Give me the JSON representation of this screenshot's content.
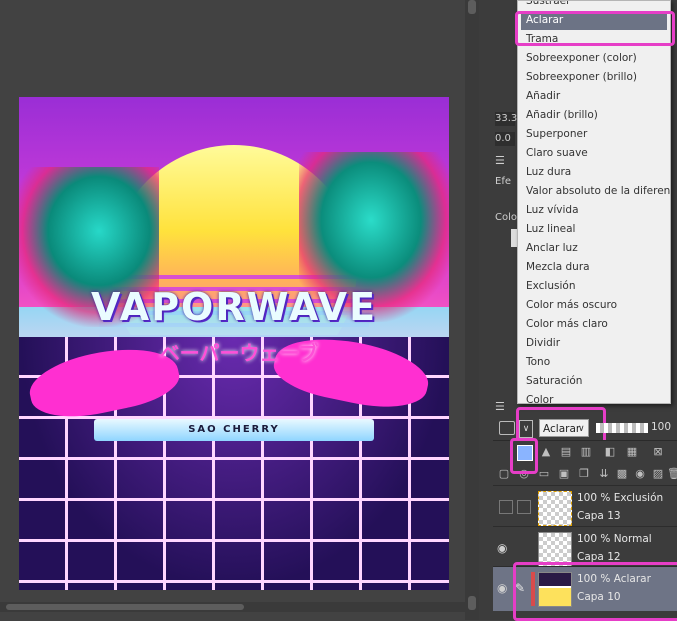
{
  "artwork": {
    "title": "VAPORWAVE",
    "subtitle": "ベーパーウェーブ",
    "credit": "SAO CHERRY"
  },
  "panel": {
    "value_a": "33.3",
    "value_b": "0.0",
    "label_efe": "Efe",
    "label_colo": "Colo"
  },
  "blend_menu": {
    "items": [
      "Sustraer",
      "Aclarar",
      "Trama",
      "Sobreexponer (color)",
      "Sobreexponer (brillo)",
      "Añadir",
      "Añadir (brillo)",
      "Superponer",
      "Claro suave",
      "Luz dura",
      "Valor absoluto de la diferencia",
      "Luz vívida",
      "Luz lineal",
      "Anclar luz",
      "Mezcla dura",
      "Exclusión",
      "Color más oscuro",
      "Color más claro",
      "Dividir",
      "Tono",
      "Saturación",
      "Color"
    ],
    "selected": "Aclarar"
  },
  "layer_toolbar": {
    "blend_mode": "Aclarar",
    "opacity": "100"
  },
  "layers": [
    {
      "mode": "100 % Exclusión",
      "name": "Capa 13"
    },
    {
      "mode": "100 % Normal",
      "name": "Capa 12"
    },
    {
      "mode": "100 % Aclarar",
      "name": "Capa 10"
    }
  ],
  "colors": {
    "highlight": "#e63ec7",
    "selected_item": "#6c7385",
    "active_layer": "#6e7486"
  }
}
